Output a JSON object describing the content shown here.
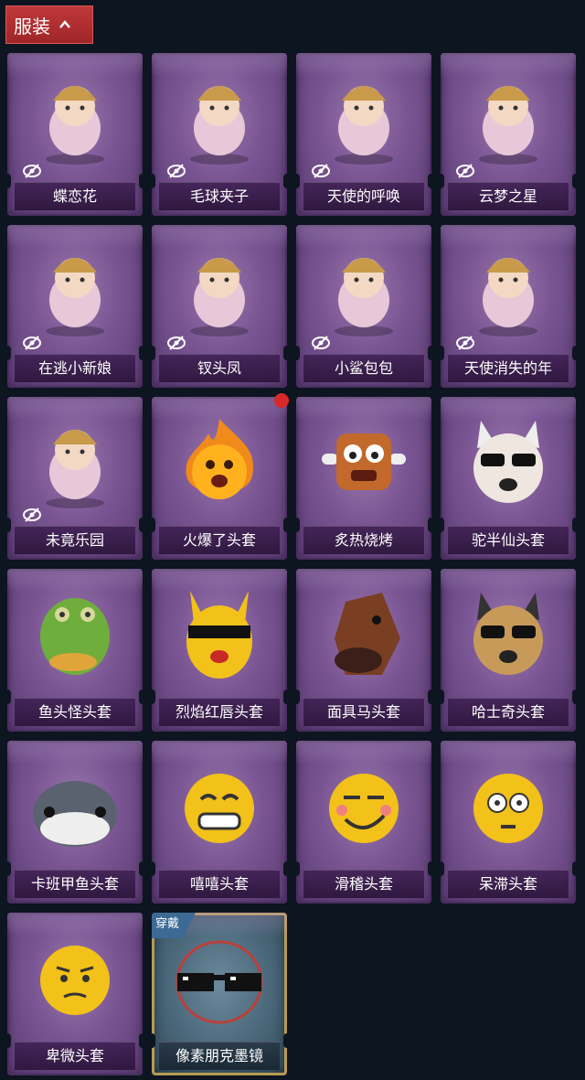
{
  "header": {
    "title": "服装",
    "collapse_icon": "chevron-up-icon",
    "accent": "#b3302f"
  },
  "items": [
    {
      "label": "蝶恋花",
      "art": "bell-crown",
      "hidden_toggle": true
    },
    {
      "label": "毛球夹子",
      "art": "raccoon-drummer",
      "hidden_toggle": true
    },
    {
      "label": "天使的呼唤",
      "art": "angel-doll",
      "hidden_toggle": true
    },
    {
      "label": "云梦之星",
      "art": "unicorn-cloud",
      "hidden_toggle": true
    },
    {
      "label": "在逃小新娘",
      "art": "red-hood-bride",
      "hidden_toggle": true
    },
    {
      "label": "钗头凤",
      "art": "phoenix-crown-doll",
      "hidden_toggle": true
    },
    {
      "label": "小鲨包包",
      "art": "shark-bag",
      "hidden_toggle": true
    },
    {
      "label": "天使消失的年",
      "art": "veiled-angel",
      "hidden_toggle": true
    },
    {
      "label": "未竟乐园",
      "art": "pink-hair-doll",
      "hidden_toggle": true
    },
    {
      "label": "火爆了头套",
      "art": "fire-face-head",
      "hidden_toggle": false,
      "new": true
    },
    {
      "label": "炙热烧烤",
      "art": "bbq-meat-head",
      "hidden_toggle": false
    },
    {
      "label": "驼半仙头套",
      "art": "alpaca-sunglasses-head",
      "hidden_toggle": false
    },
    {
      "label": "鱼头怪头套",
      "art": "fish-head",
      "hidden_toggle": false
    },
    {
      "label": "烈焰红唇头套",
      "art": "yellow-pikachu-head",
      "hidden_toggle": false
    },
    {
      "label": "面具马头套",
      "art": "horse-mask",
      "hidden_toggle": false
    },
    {
      "label": "哈士奇头套",
      "art": "husky-sunglasses-head",
      "hidden_toggle": false
    },
    {
      "label": "卡班甲鱼头套",
      "art": "whale-head",
      "hidden_toggle": false
    },
    {
      "label": "嘻嘻头套",
      "art": "grin-emoji-head",
      "hidden_toggle": false
    },
    {
      "label": "滑稽头套",
      "art": "funny-emoji-head",
      "hidden_toggle": false
    },
    {
      "label": "呆滞头套",
      "art": "stunned-emoji-head",
      "hidden_toggle": false
    },
    {
      "label": "卑微头套",
      "art": "humble-emoji-head",
      "hidden_toggle": false
    },
    {
      "label": "像素朋克墨镜",
      "art": "pixel-sunglasses",
      "hidden_toggle": false,
      "equipped": true,
      "badge": "穿戴"
    }
  ],
  "colors": {
    "card": "#7a5593",
    "equipped_border": "#b99a52",
    "badge": "#3d6a95",
    "new_dot": "#d9282a"
  }
}
